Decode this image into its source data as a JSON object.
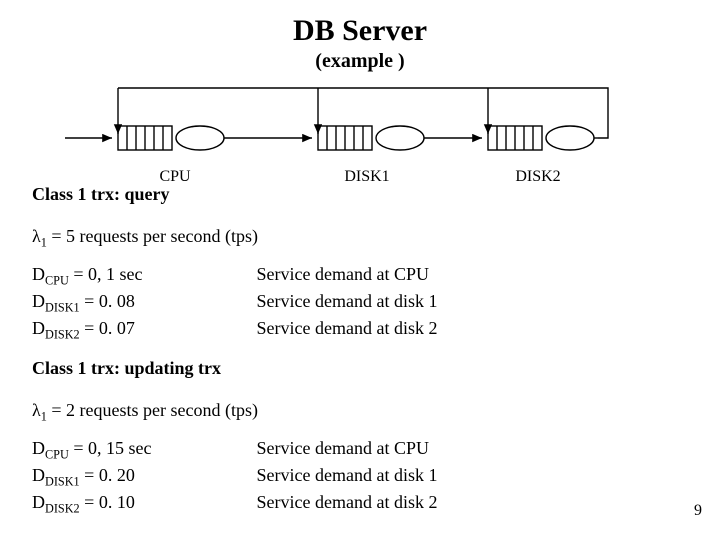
{
  "title": "DB Server",
  "subtitle": "(example )",
  "diagram": {
    "nodes": {
      "cpu": "CPU",
      "disk1": "DISK1",
      "disk2": "DISK2"
    }
  },
  "class1": {
    "heading": "Class 1 trx: query",
    "lambda_sym": "λ",
    "lambda_sub": "1",
    "lambda_rest": " = 5 requests per second (tps)",
    "rows": [
      {
        "D": "D",
        "sub": "CPU",
        "val": " = 0, 1 sec",
        "desc": "Service demand at CPU"
      },
      {
        "D": "D",
        "sub": "DISK1",
        "val": " = 0. 08",
        "desc": "Service demand at disk 1"
      },
      {
        "D": "D",
        "sub": "DISK2",
        "val": " = 0. 07",
        "desc": "Service demand at disk 2"
      }
    ]
  },
  "class2": {
    "heading": "Class 1 trx: updating trx",
    "lambda_sym": "λ",
    "lambda_sub": "1",
    "lambda_rest": " = 2 requests per second (tps)",
    "rows": [
      {
        "D": "D",
        "sub": "CPU",
        "val": " = 0, 15 sec",
        "desc": "Service demand at CPU"
      },
      {
        "D": "D",
        "sub": "DISK1",
        "val": " = 0. 20",
        "desc": "Service demand at disk 1"
      },
      {
        "D": "D",
        "sub": "DISK2",
        "val": " = 0. 10",
        "desc": "Service demand at disk 2"
      }
    ]
  },
  "page_number": "9"
}
